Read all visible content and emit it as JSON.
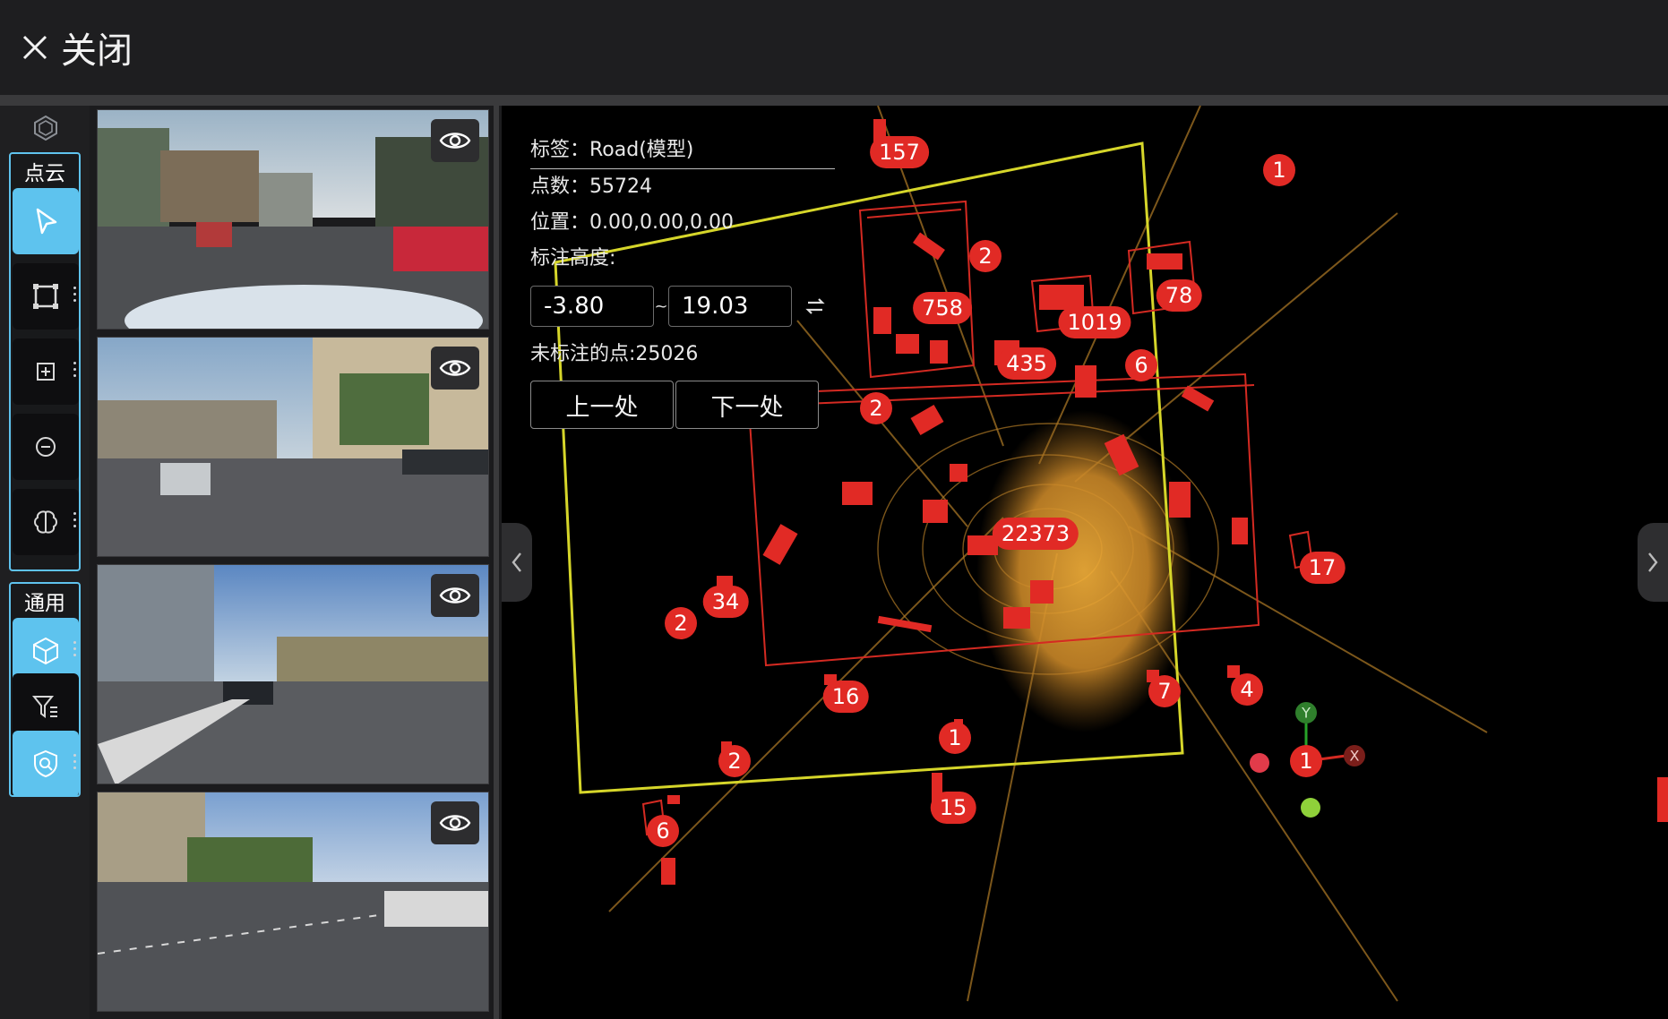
{
  "header": {
    "close_label": "关闭"
  },
  "toolbar": {
    "pointcloud_group": "点云",
    "general_group": "通用",
    "accent_color": "#5ec3ee"
  },
  "cameras": [
    {
      "eye": "eye-icon"
    },
    {
      "eye": "eye-icon"
    },
    {
      "eye": "eye-icon"
    },
    {
      "eye": "eye-icon"
    }
  ],
  "info": {
    "label_text": "标签：Road(模型)",
    "points_text": "点数：55724",
    "position_text": "位置：0.00,0.00,0.00",
    "height_title": "标注高度:",
    "height_min": "-3.80",
    "height_max": "19.03",
    "tilde": "~",
    "unlabeled_text": "未标注的点:25026",
    "prev_label": "上一处",
    "next_label": "下一处"
  },
  "badges": [
    {
      "id": "157",
      "text": "157"
    },
    {
      "id": "1a",
      "text": "1"
    },
    {
      "id": "2a",
      "text": "2"
    },
    {
      "id": "78",
      "text": "78"
    },
    {
      "id": "758",
      "text": "758"
    },
    {
      "id": "1019",
      "text": "1019"
    },
    {
      "id": "435",
      "text": "435"
    },
    {
      "id": "6a",
      "text": "6"
    },
    {
      "id": "2b",
      "text": "2"
    },
    {
      "id": "22373",
      "text": "22373"
    },
    {
      "id": "17",
      "text": "17"
    },
    {
      "id": "34",
      "text": "34"
    },
    {
      "id": "2c",
      "text": "2"
    },
    {
      "id": "16",
      "text": "16"
    },
    {
      "id": "7",
      "text": "7"
    },
    {
      "id": "4",
      "text": "4"
    },
    {
      "id": "1b",
      "text": "1"
    },
    {
      "id": "2d",
      "text": "2"
    },
    {
      "id": "1c",
      "text": "1"
    },
    {
      "id": "15",
      "text": "15"
    },
    {
      "id": "6b",
      "text": "6"
    }
  ],
  "axes": {
    "y_label": "Y",
    "x_label": "X"
  }
}
